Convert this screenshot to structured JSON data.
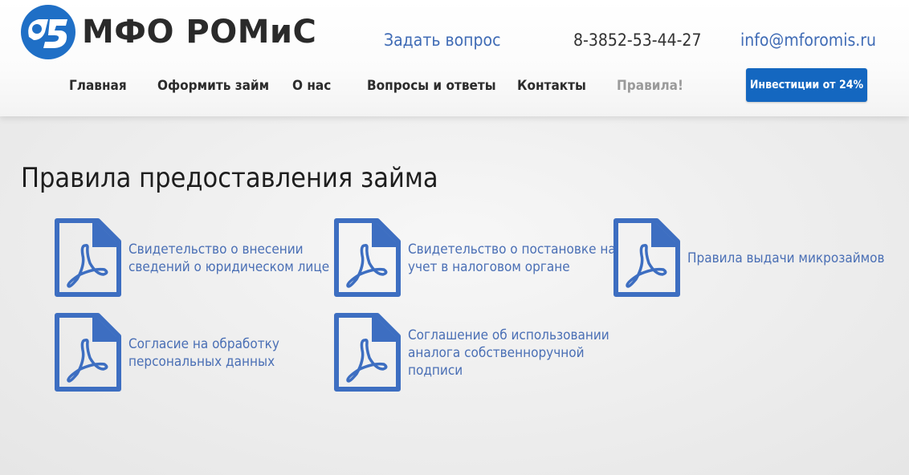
{
  "header": {
    "logo_text": "МФО РОМиС",
    "ask_link": "Задать вопрос",
    "phone": "8-3852-53-44-27",
    "email": "info@mforomis.ru",
    "invest_button": "Инвестиции от 24%",
    "nav": [
      {
        "label": "Главная",
        "active": false
      },
      {
        "label": "Оформить займ",
        "active": false
      },
      {
        "label": "О нас",
        "active": false
      },
      {
        "label": "Вопросы и ответы",
        "active": false
      },
      {
        "label": "Контакты",
        "active": false
      },
      {
        "label": "Правила!",
        "active": true
      }
    ]
  },
  "main": {
    "title": "Правила предоставления займа",
    "documents": [
      {
        "lines": [
          "Свидетельство о внесении",
          "сведений о юридическом лице"
        ],
        "icon": "pdf-icon"
      },
      {
        "lines": [
          "Свидетельство о постановке на",
          "учет в налоговом органе"
        ],
        "icon": "pdf-icon"
      },
      {
        "lines": [
          "Правила выдачи микрозаймов"
        ],
        "icon": "pdf-icon"
      },
      {
        "lines": [
          "Согласие на обработку",
          "персональных данных"
        ],
        "icon": "pdf-icon"
      },
      {
        "lines": [
          "Соглашение об использовании",
          "аналога собственноручной",
          "подписи"
        ],
        "icon": "pdf-icon"
      }
    ]
  },
  "colors": {
    "brand_blue": "#1467c0",
    "link_blue": "#3f6bb5",
    "icon_blue": "#3d6ec1",
    "nav_active": "#9a9a9a"
  }
}
